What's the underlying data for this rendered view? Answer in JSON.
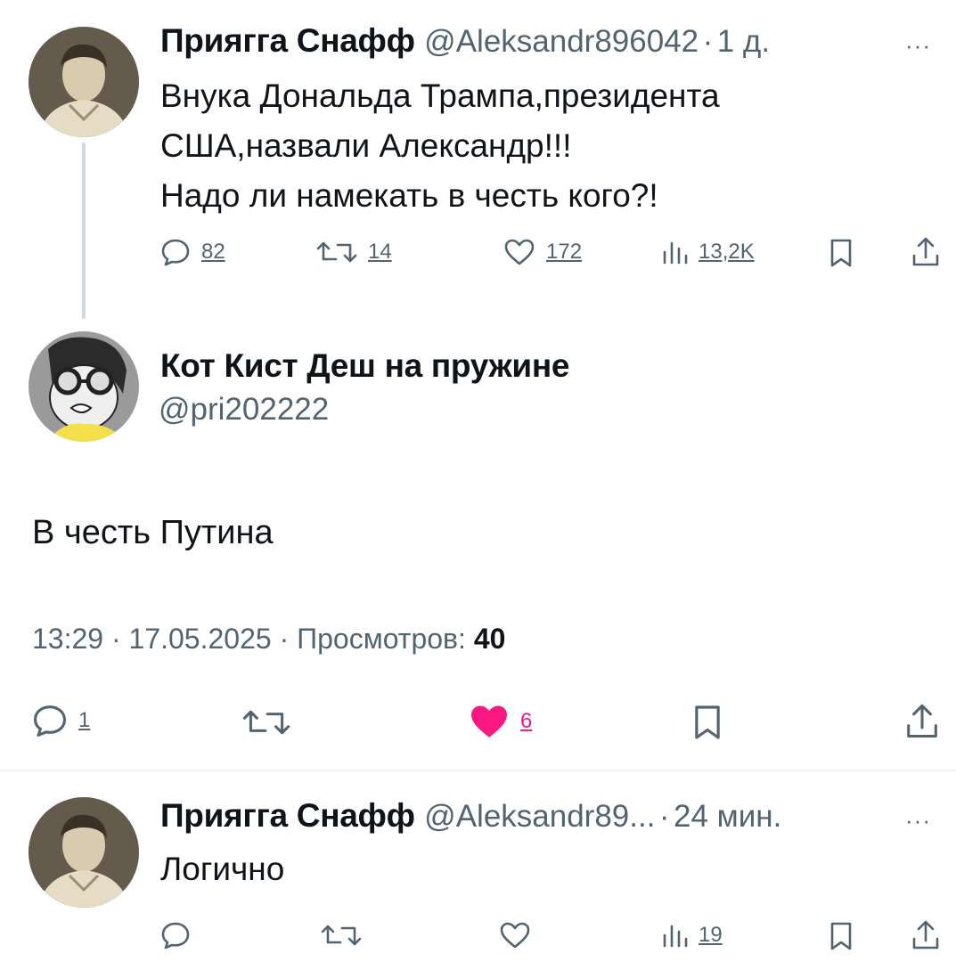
{
  "tweet1": {
    "name": "Приягга Снафф",
    "handle": "@Aleksandr896042",
    "separator": "·",
    "time": "1 д.",
    "more": "···",
    "lines": [
      "Внука Дональда Трампа,президента",
      "США,назвали Александр!!!",
      "Надо ли намекать в честь кого?!"
    ],
    "actions": {
      "replies": "82",
      "retweets": "14",
      "likes": "172",
      "views": "13,2K"
    }
  },
  "main": {
    "name": "Кот Кист Деш на пружине",
    "handle": "@pri202222",
    "text": "В честь Путина",
    "time": "13:29",
    "dot": "·",
    "date": "17.05.2025",
    "views_label": "Просмотров:",
    "views_count": "40",
    "actions": {
      "replies": "1",
      "likes": "6"
    },
    "like_color": "#f91880"
  },
  "tweet3": {
    "name": "Приягга Снафф",
    "handle": "@Aleksandr89...",
    "separator": "·",
    "time": "24 мин.",
    "more": "···",
    "text": "Логично",
    "actions": {
      "views": "19"
    }
  },
  "icons": [
    "reply-icon",
    "retweet-icon",
    "like-icon",
    "views-icon",
    "bookmark-icon",
    "share-icon"
  ]
}
